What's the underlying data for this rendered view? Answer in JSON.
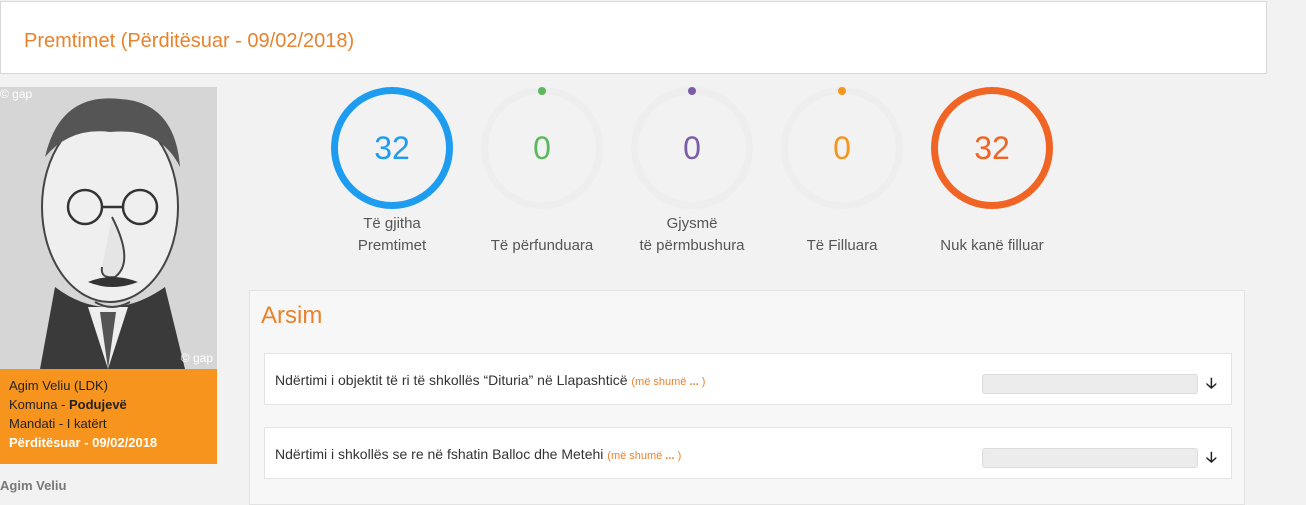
{
  "header": {
    "title": "Premtimet (Përditësuar - 09/02/2018)"
  },
  "profile": {
    "watermark": "© gap",
    "name_party": "Agim Veliu (LDK)",
    "municipality_label": "Komuna - ",
    "municipality": "Podujevë",
    "mandate": "Mandati - I katërt",
    "updated": "Përditësuar - 09/02/2018",
    "side_name": "Agim Veliu"
  },
  "stats": [
    {
      "value": "32",
      "line1": "Të gjitha",
      "line2": "Premtimet",
      "color": "#1e9cf0",
      "filled": true
    },
    {
      "value": "0",
      "line1": "",
      "line2": "Të përfunduara",
      "color": "#5cb85c",
      "filled": false
    },
    {
      "value": "0",
      "line1": "Gjysmë",
      "line2": "të përmbushura",
      "color": "#7b5ea7",
      "filled": false
    },
    {
      "value": "0",
      "line1": "",
      "line2": "Të Filluara",
      "color": "#f7941d",
      "filled": false
    },
    {
      "value": "32",
      "line1": "",
      "line2": "Nuk kanë filluar",
      "color": "#f06424",
      "filled": true
    }
  ],
  "section": {
    "title": "Arsim",
    "items": [
      {
        "text": "Ndërtimi i objektit të ri të shkollës “Dituria” në Llapashticë",
        "more": "(më shumë",
        "more_dots": "...",
        "more_end": ")",
        "progress": 0
      },
      {
        "text": "Ndërtimi i shkollës se re në fshatin Balloc dhe Metehi",
        "more": "(më shumë",
        "more_dots": "...",
        "more_end": ")",
        "progress": 0
      }
    ]
  },
  "colors": {
    "accent": "#e8822c",
    "info_box": "#f7941d"
  },
  "icons": {
    "expand": "arrow-down-icon"
  }
}
